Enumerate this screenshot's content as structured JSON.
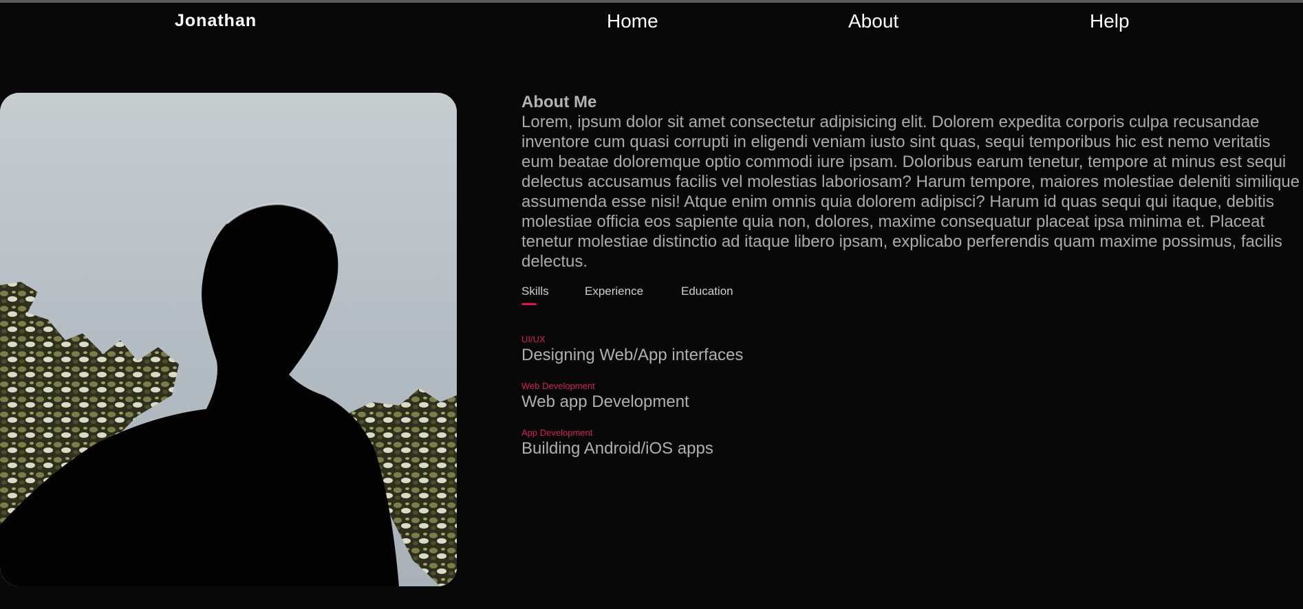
{
  "nav": {
    "brand": "Jonathan",
    "links": [
      "Home",
      "About",
      "Help"
    ]
  },
  "photo": {
    "alt": "Silhouette of a person against sky and trees"
  },
  "about": {
    "title": "About Me",
    "text": "Lorem, ipsum dolor sit amet consectetur adipisicing elit. Dolorem expedita corporis culpa recusandae inventore cum quasi corrupti in eligendi veniam iusto sint quas, sequi temporibus hic est nemo veritatis eum beatae doloremque optio commodi iure ipsam. Doloribus earum tenetur, tempore at minus est sequi delectus accusamus facilis vel molestias laboriosam? Harum tempore, maiores molestiae deleniti similique assumenda esse nisi! Atque enim omnis quia dolorem adipisci? Harum id quas sequi qui itaque, debitis molestiae officia eos sapiente quia non, dolores, maxime consequatur placeat ipsa minima et. Placeat tenetur molestiae distinctio ad itaque libero ipsam, explicabo perferendis quam maxime possimus, facilis delectus."
  },
  "tabs": {
    "items": [
      "Skills",
      "Experience",
      "Education"
    ],
    "active": "Skills"
  },
  "skills": [
    {
      "tag": "UI/UX",
      "desc": "Designing Web/App interfaces"
    },
    {
      "tag": "Web Development",
      "desc": "Web app Development"
    },
    {
      "tag": "App Development",
      "desc": "Building Android/iOS apps"
    }
  ],
  "colors": {
    "background": "#080808",
    "accent": "#e0134a",
    "text": "#ababab"
  }
}
